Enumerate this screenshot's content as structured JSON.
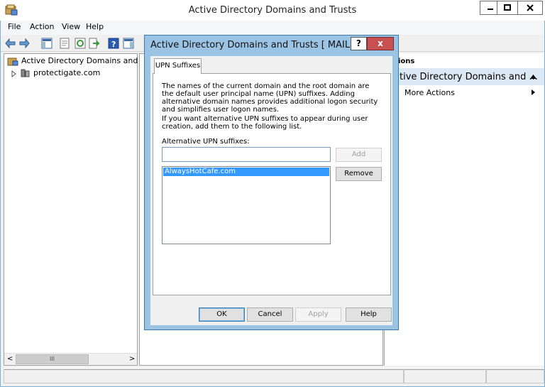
{
  "window": {
    "title": "Active Directory Domains and Trusts",
    "accent": "#7fb0d6"
  },
  "menu": [
    "File",
    "Action",
    "View",
    "Help"
  ],
  "tree": {
    "root": "Active Directory Domains and Trust",
    "child": "protectigate.com"
  },
  "actions": {
    "header": "ions",
    "section": "tive Directory Domains and ...",
    "more": "More Actions"
  },
  "dialog": {
    "title": "Active Directory Domains and Trusts [ MAIL.pro...",
    "help_glyph": "?",
    "close_glyph": "x",
    "tab": "UPN Suffixes",
    "para1": "The names of the current domain and the root domain are the default user principal name (UPN) suffixes. Adding alternative domain names provides additional logon security and simplifies user logon names.",
    "para2": "If you want alternative UPN suffixes to appear during user creation, add them to the following list.",
    "field_label": "Alternative UPN suffixes:",
    "input_value": "",
    "add": "Add",
    "remove": "Remove",
    "suffixes": [
      "AlwaysHotCafe.com"
    ],
    "ok": "OK",
    "cancel": "Cancel",
    "apply": "Apply",
    "help": "Help"
  },
  "scrollbar": {
    "thumb_glyph": "III"
  }
}
